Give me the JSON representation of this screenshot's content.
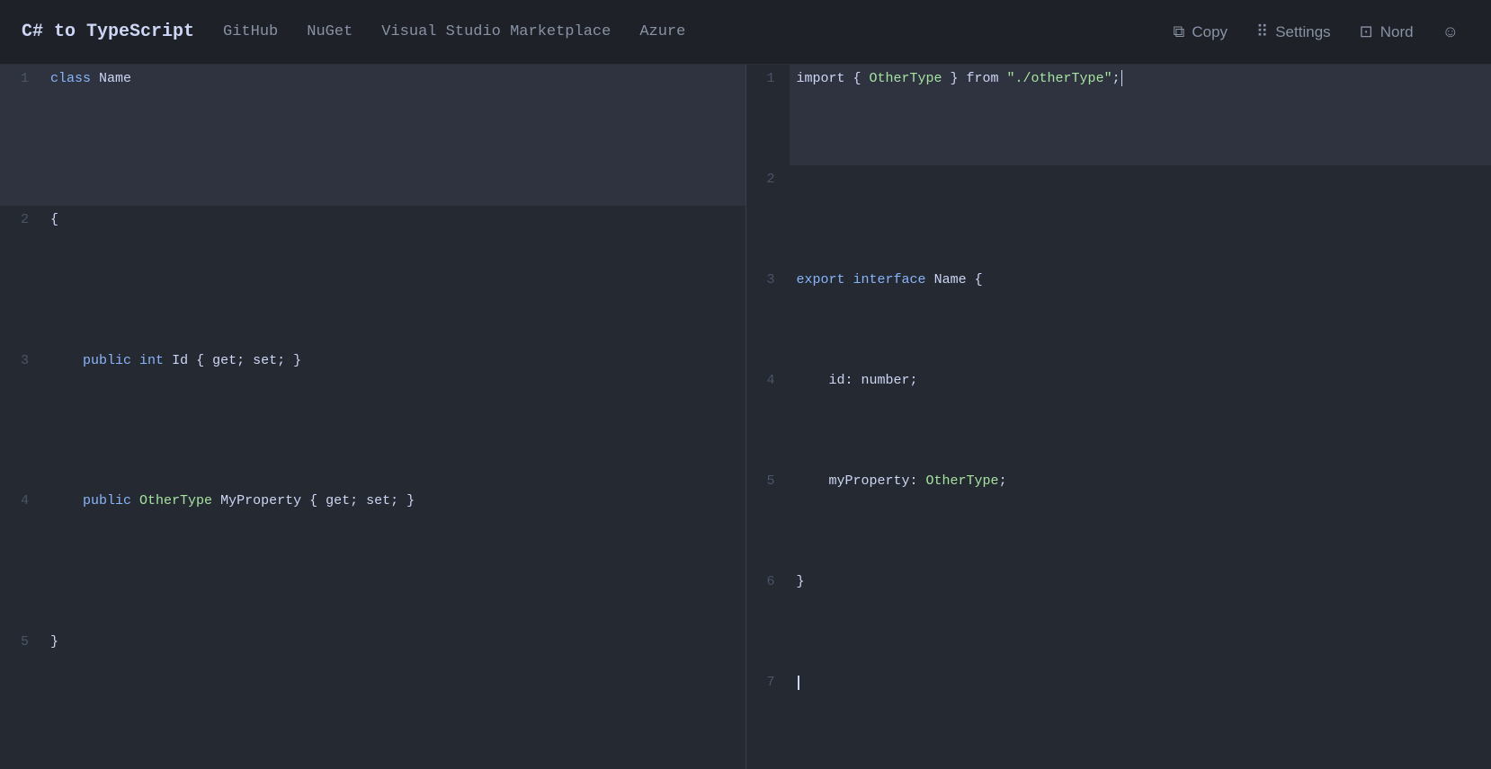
{
  "navbar": {
    "brand": "C# to TypeScript",
    "links": [
      "GitHub",
      "NuGet",
      "Visual Studio Marketplace",
      "Azure"
    ],
    "copy_label": "Copy",
    "settings_label": "Settings",
    "nord_label": "Nord"
  },
  "left_panel": {
    "lines": [
      {
        "num": 1,
        "tokens": [
          {
            "t": "class",
            "cls": "kw"
          },
          {
            "t": " "
          },
          {
            "t": "Name",
            "cls": "type-name"
          }
        ],
        "highlighted": true
      },
      {
        "num": 2,
        "tokens": [
          {
            "t": "{",
            "cls": "brace"
          }
        ]
      },
      {
        "num": 3,
        "tokens": [
          {
            "t": "    "
          },
          {
            "t": "public",
            "cls": "kw-public"
          },
          {
            "t": " "
          },
          {
            "t": "int",
            "cls": "kw-int"
          },
          {
            "t": " Id { get; set; }"
          }
        ]
      },
      {
        "num": 4,
        "tokens": [
          {
            "t": "    "
          },
          {
            "t": "public",
            "cls": "kw-public"
          },
          {
            "t": " "
          },
          {
            "t": "OtherType",
            "cls": "other-type"
          },
          {
            "t": " MyProperty { get; set; }"
          }
        ]
      },
      {
        "num": 5,
        "tokens": [
          {
            "t": "}",
            "cls": "brace"
          }
        ]
      }
    ]
  },
  "right_panel": {
    "lines": [
      {
        "num": 1,
        "tokens": [
          {
            "t": "import"
          },
          {
            "t": " { "
          },
          {
            "t": "OtherType",
            "cls": "other-type"
          },
          {
            "t": " } from "
          },
          {
            "t": "\"./otherType\"",
            "cls": "string-val"
          },
          {
            "t": ";"
          }
        ]
      },
      {
        "num": 2,
        "tokens": []
      },
      {
        "num": 3,
        "tokens": [
          {
            "t": "export",
            "cls": "export-kw"
          },
          {
            "t": " "
          },
          {
            "t": "interface",
            "cls": "interface-kw"
          },
          {
            "t": " "
          },
          {
            "t": "Name",
            "cls": "type-name"
          },
          {
            "t": " {"
          }
        ]
      },
      {
        "num": 4,
        "tokens": [
          {
            "t": "    id: number;"
          }
        ]
      },
      {
        "num": 5,
        "tokens": [
          {
            "t": "    myProperty: "
          },
          {
            "t": "OtherType",
            "cls": "other-type"
          },
          {
            "t": ";"
          }
        ]
      },
      {
        "num": 6,
        "tokens": [
          {
            "t": "}"
          }
        ]
      },
      {
        "num": 7,
        "tokens": [],
        "cursor": true
      }
    ]
  },
  "colors": {
    "bg": "#252932",
    "nav_bg": "#1e2128",
    "highlight_line": "#2e333f",
    "line_number": "#4a5568",
    "keyword": "#89b4fa",
    "other_type": "#a6e3a1",
    "string": "#a6e3a1",
    "text": "#cdd6f4"
  }
}
